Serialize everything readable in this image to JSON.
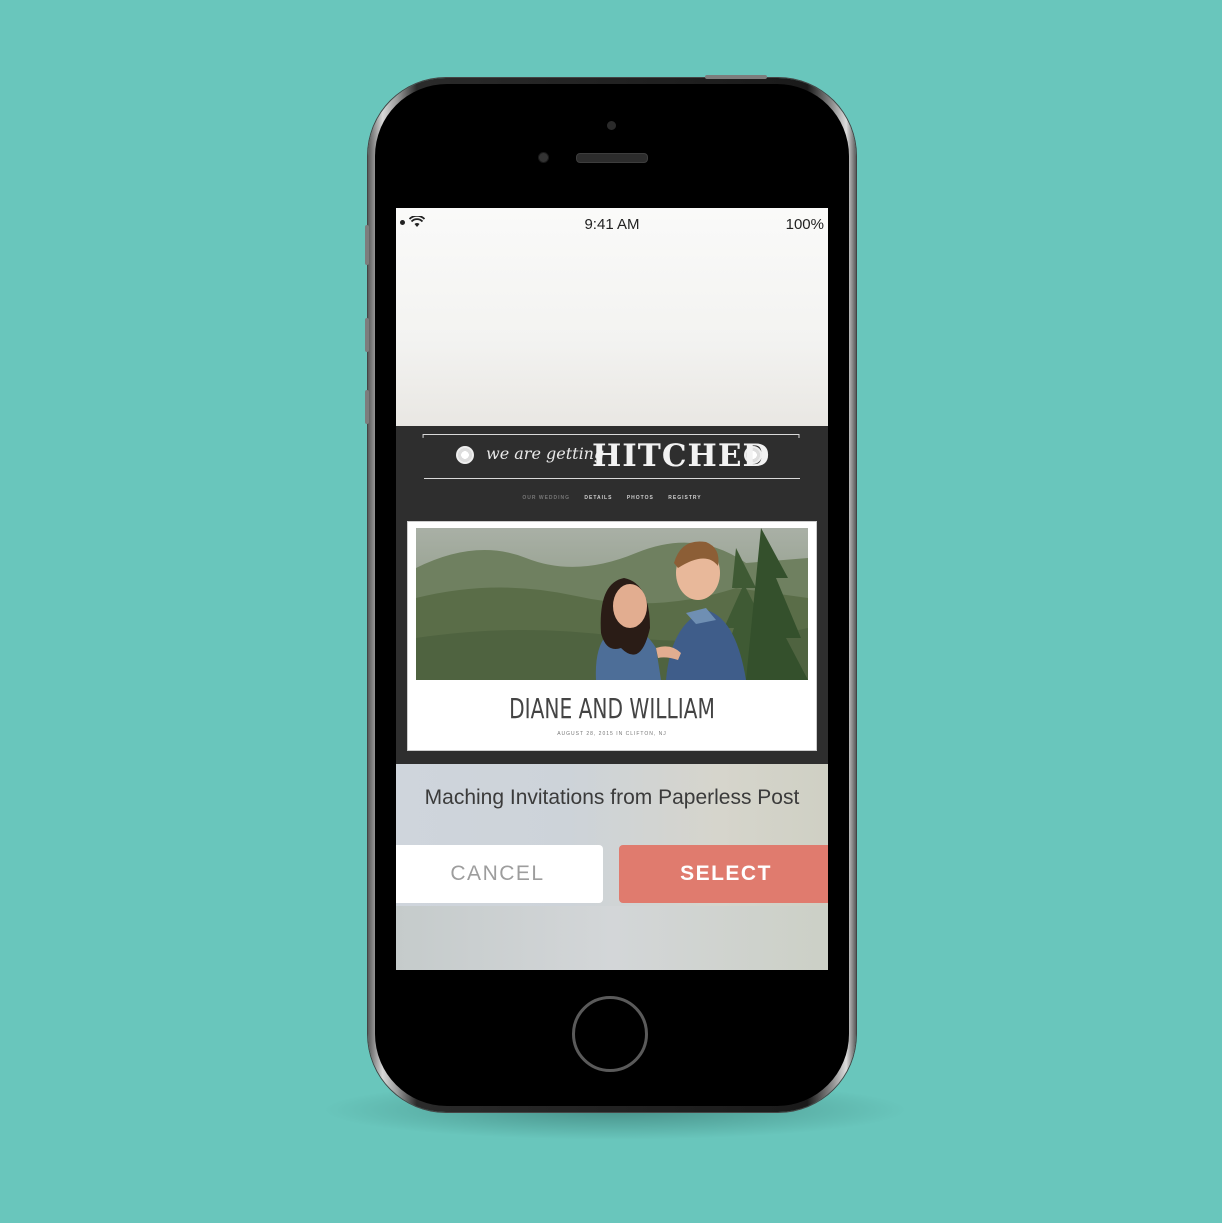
{
  "status_bar": {
    "time": "9:41 AM",
    "battery": "100%"
  },
  "website": {
    "script_text": "we are getting",
    "headline": "HITCHED",
    "nav_items": [
      "OUR WEDDING",
      "DETAILS",
      "PHOTOS",
      "REGISTRY"
    ],
    "couple_names": "DIANE AND WILLIAM",
    "event_line": "AUGUST 28, 2015 IN CLIFTON, NJ"
  },
  "sheet": {
    "title": "Maching Invitations from Paperless Post",
    "cancel_label": "CANCEL",
    "select_label": "SELECT"
  },
  "colors": {
    "background": "#69c6bc",
    "select_button": "#e07b6e",
    "header_dark": "#2e2e2e"
  }
}
